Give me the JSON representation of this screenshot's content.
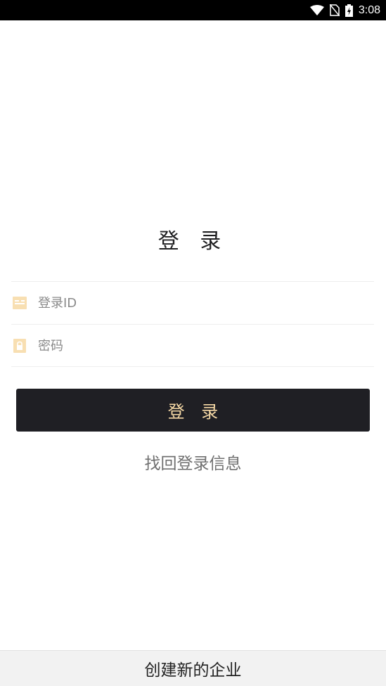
{
  "status_bar": {
    "time": "3:08",
    "icons": [
      "wifi-icon",
      "no-sim-icon",
      "battery-charging-icon"
    ]
  },
  "title": "登 录",
  "fields": {
    "login_id": {
      "placeholder": "登录ID",
      "value": "",
      "icon": "id-card-icon"
    },
    "password": {
      "placeholder": "密码",
      "value": "",
      "icon": "lock-icon"
    }
  },
  "buttons": {
    "login_label": "登 录",
    "recover_label": "找回登录信息",
    "create_enterprise_label": "创建新的企业"
  },
  "colors": {
    "accent": "#f6d9a6",
    "button_bg": "#1f1f24",
    "icon_tint": "#f8dfb2"
  }
}
